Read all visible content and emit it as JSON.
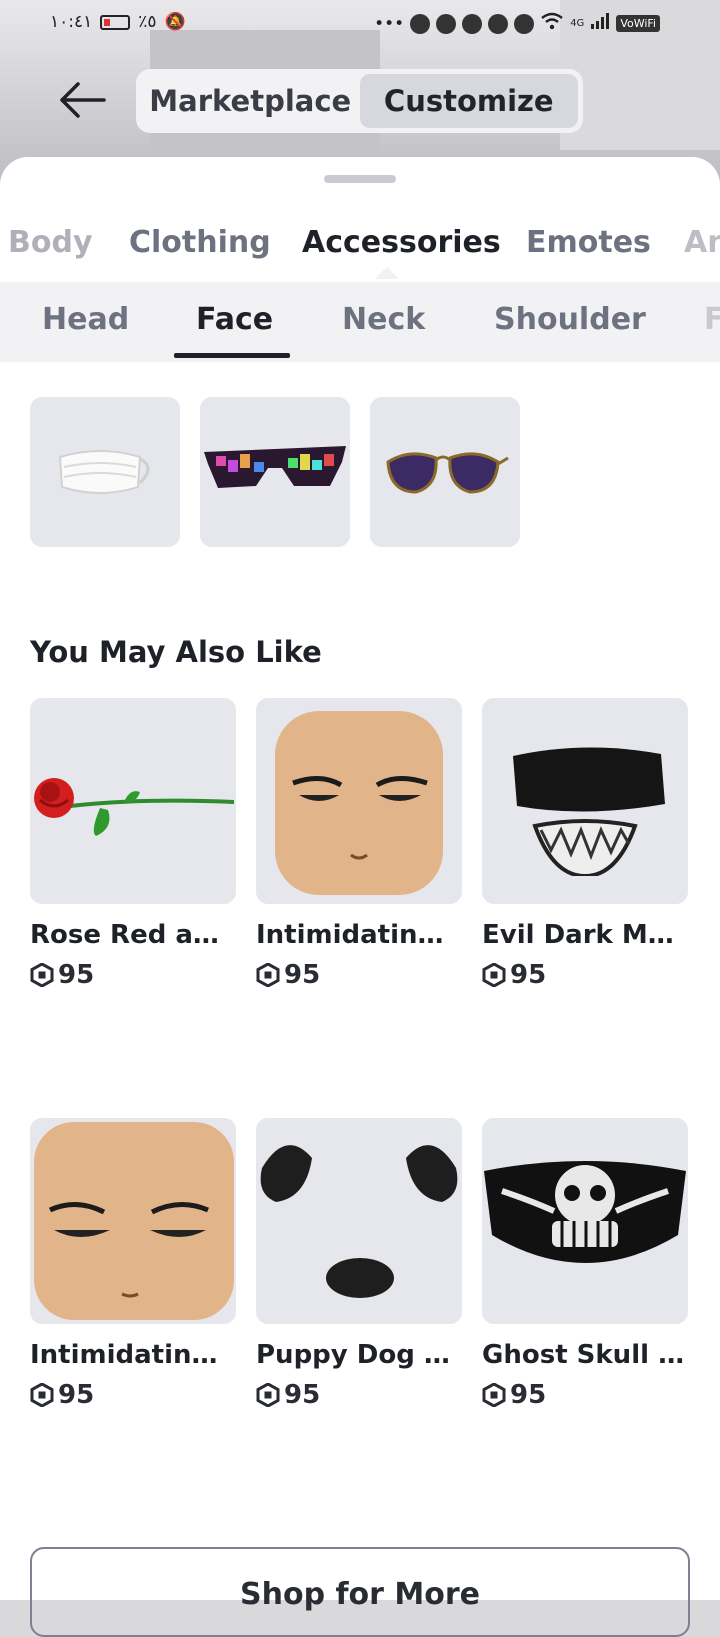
{
  "status_bar": {
    "time": "١٠:٤١",
    "battery": "٪٥",
    "network": "4G",
    "vowifi": "VoWiFi"
  },
  "header": {
    "back_icon": "arrow-left-icon",
    "toggle": [
      {
        "label": "Marketplace",
        "active": false
      },
      {
        "label": "Customize",
        "active": true
      }
    ]
  },
  "category_tabs": [
    "Body",
    "Clothing",
    "Accessories",
    "Emotes",
    "An"
  ],
  "active_category": "Accessories",
  "sub_tabs": [
    "Head",
    "Face",
    "Neck",
    "Shoulder",
    "F"
  ],
  "active_sub_tab": "Face",
  "equipped_items": [
    {
      "icon": "face-mask-icon"
    },
    {
      "icon": "led-glasses-icon"
    },
    {
      "icon": "aviator-sunglasses-icon"
    }
  ],
  "recommendations": {
    "title": "You May Also Like",
    "items": [
      {
        "name": "Rose Red and ...",
        "price": "95",
        "icon": "rose-icon"
      },
      {
        "name": "Intimidating F...",
        "price": "95",
        "icon": "face-icon"
      },
      {
        "name": "Evil Dark Mum...",
        "price": "95",
        "icon": "mummy-mask-icon"
      },
      {
        "name": "Intimidating S...",
        "price": "95",
        "icon": "face-icon"
      },
      {
        "name": "Puppy Dog Fa...",
        "price": "95",
        "icon": "puppy-face-icon"
      },
      {
        "name": "Ghost Skull M...",
        "price": "95",
        "icon": "skull-mask-icon"
      }
    ]
  },
  "shop_button": {
    "label": "Shop for More"
  }
}
